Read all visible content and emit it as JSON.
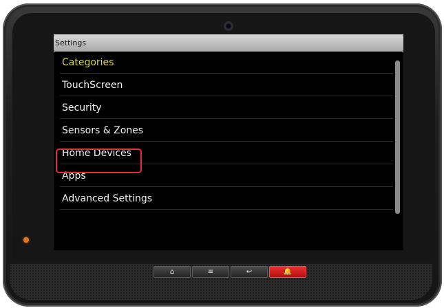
{
  "screen": {
    "title": "Settings",
    "categories_header": "Categories",
    "items": [
      {
        "label": "TouchScreen"
      },
      {
        "label": "Security"
      },
      {
        "label": "Sensors & Zones"
      },
      {
        "label": "Home Devices",
        "highlighted": true
      },
      {
        "label": "Apps"
      },
      {
        "label": "Advanced Settings"
      }
    ]
  },
  "hardware_buttons": [
    {
      "icon": "home-icon",
      "glyph": "⌂"
    },
    {
      "icon": "menu-icon",
      "glyph": "≡"
    },
    {
      "icon": "back-icon",
      "glyph": "↩"
    },
    {
      "icon": "emergency-icon",
      "glyph": "🔔"
    }
  ],
  "colors": {
    "header_text": "#d6d630",
    "highlight_border": "#e03030",
    "emergency_button": "#e02020",
    "led": "#e07820"
  }
}
